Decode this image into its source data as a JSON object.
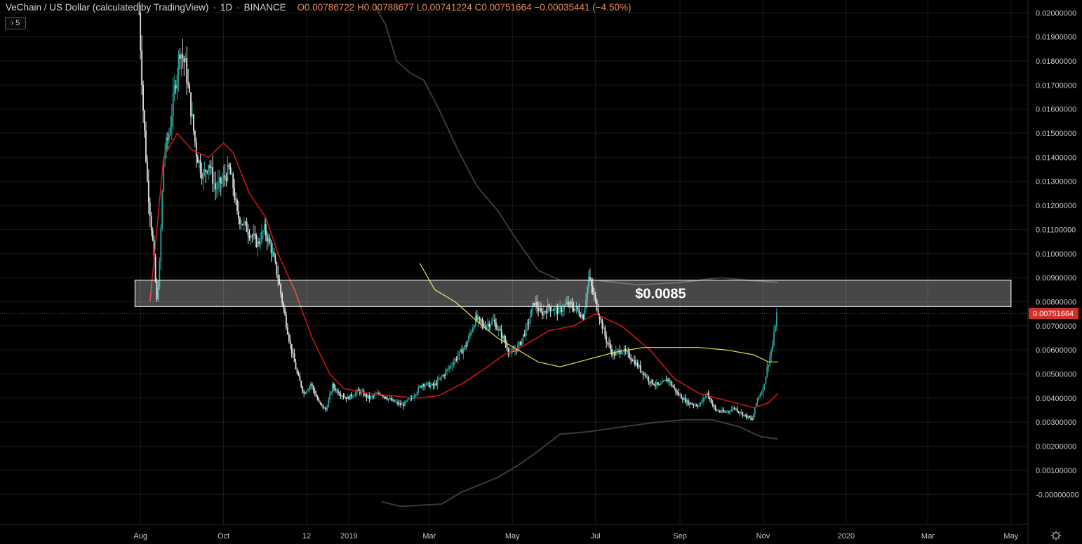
{
  "header": {
    "symbol": "VeChain / US Dollar (calculated by TradingView)",
    "interval": "1D",
    "exchange": "BINANCE",
    "open": "O0.00786722",
    "high": "H0.00788677",
    "low": "L0.00741224",
    "close": "C0.00751664",
    "change": "−0.00035441 (−4.50%)"
  },
  "hidden_indicators_label": "5",
  "settings_icon": "gear-icon",
  "colors": {
    "background": "#000000",
    "grid": "#1c1c1c",
    "axis_text": "#c8c8c8",
    "candle_up": "#26a69a",
    "candle_down": "#e0e0e0",
    "ma_red": "#d41616",
    "ma_yellow": "#e6e04a",
    "band_gray": "#3a3a3a",
    "price_tag": "#d0302a"
  },
  "chart_data": {
    "type": "candlestick",
    "ylim": [
      -0.0004,
      0.0203
    ],
    "y_ticks": [
      "0.02000000",
      "0.01900000",
      "0.01800000",
      "0.01700000",
      "0.01600000",
      "0.01500000",
      "0.01400000",
      "0.01300000",
      "0.01200000",
      "0.01100000",
      "0.01000000",
      "0.00900000",
      "0.00800000",
      "0.00700000",
      "0.00600000",
      "0.00500000",
      "0.00400000",
      "0.00300000",
      "0.00200000",
      "0.00100000",
      "-0.00000000"
    ],
    "y_tick_values": [
      0.02,
      0.019,
      0.018,
      0.017,
      0.016,
      0.015,
      0.014,
      0.013,
      0.012,
      0.011,
      0.01,
      0.009,
      0.008,
      0.007,
      0.006,
      0.005,
      0.004,
      0.003,
      0.002,
      0.001,
      0.0
    ],
    "x_ticks": [
      "Aug",
      "Oct",
      "12",
      "2019",
      "Mar",
      "May",
      "Jul",
      "Sep",
      "Nov",
      "2020",
      "Mar",
      "May"
    ],
    "x_tick_dates": [
      "2018-08-01",
      "2018-10-01",
      "2018-12-01",
      "2019-01-01",
      "2019-03-01",
      "2019-05-01",
      "2019-07-01",
      "2019-09-01",
      "2019-11-01",
      "2020-01-01",
      "2020-03-01",
      "2020-05-01"
    ],
    "last_price": "0.00751664",
    "last_price_value": 0.00751664,
    "zone": {
      "label": "$0.0085",
      "low": 0.0078,
      "high": 0.0089,
      "start": "2018-07-28",
      "end": "2020-05-01"
    },
    "price_path": [
      [
        "2018-07-31",
        0.02
      ],
      [
        "2018-08-03",
        0.016
      ],
      [
        "2018-08-06",
        0.013
      ],
      [
        "2018-08-10",
        0.0105
      ],
      [
        "2018-08-13",
        0.008
      ],
      [
        "2018-08-15",
        0.0095
      ],
      [
        "2018-08-18",
        0.014
      ],
      [
        "2018-08-22",
        0.015
      ],
      [
        "2018-08-26",
        0.0168
      ],
      [
        "2018-08-30",
        0.0185
      ],
      [
        "2018-09-03",
        0.0178
      ],
      [
        "2018-09-07",
        0.016
      ],
      [
        "2018-09-11",
        0.0142
      ],
      [
        "2018-09-16",
        0.0132
      ],
      [
        "2018-09-20",
        0.0138
      ],
      [
        "2018-09-25",
        0.0127
      ],
      [
        "2018-09-30",
        0.013
      ],
      [
        "2018-10-05",
        0.0135
      ],
      [
        "2018-10-08",
        0.0128
      ],
      [
        "2018-10-11",
        0.0116
      ],
      [
        "2018-10-16",
        0.0112
      ],
      [
        "2018-10-21",
        0.0108
      ],
      [
        "2018-10-26",
        0.0104
      ],
      [
        "2018-10-31",
        0.011
      ],
      [
        "2018-11-05",
        0.0102
      ],
      [
        "2018-11-10",
        0.009
      ],
      [
        "2018-11-14",
        0.0077
      ],
      [
        "2018-11-19",
        0.0062
      ],
      [
        "2018-11-24",
        0.005
      ],
      [
        "2018-11-29",
        0.0042
      ],
      [
        "2018-12-04",
        0.0046
      ],
      [
        "2018-12-10",
        0.0038
      ],
      [
        "2018-12-15",
        0.0035
      ],
      [
        "2018-12-20",
        0.0045
      ],
      [
        "2018-12-25",
        0.0042
      ],
      [
        "2018-12-31",
        0.004
      ],
      [
        "2019-01-08",
        0.0043
      ],
      [
        "2019-01-16",
        0.004
      ],
      [
        "2019-01-24",
        0.0042
      ],
      [
        "2019-02-01",
        0.0039
      ],
      [
        "2019-02-09",
        0.0037
      ],
      [
        "2019-02-16",
        0.004
      ],
      [
        "2019-02-24",
        0.0046
      ],
      [
        "2019-03-04",
        0.0045
      ],
      [
        "2019-03-12",
        0.005
      ],
      [
        "2019-03-20",
        0.0056
      ],
      [
        "2019-03-28",
        0.0062
      ],
      [
        "2019-04-04",
        0.0073
      ],
      [
        "2019-04-10",
        0.007
      ],
      [
        "2019-04-17",
        0.0072
      ],
      [
        "2019-04-24",
        0.0065
      ],
      [
        "2019-04-30",
        0.0058
      ],
      [
        "2019-05-06",
        0.0062
      ],
      [
        "2019-05-12",
        0.007
      ],
      [
        "2019-05-17",
        0.008
      ],
      [
        "2019-05-22",
        0.0075
      ],
      [
        "2019-05-28",
        0.0078
      ],
      [
        "2019-06-04",
        0.0076
      ],
      [
        "2019-06-10",
        0.0079
      ],
      [
        "2019-06-17",
        0.0077
      ],
      [
        "2019-06-22",
        0.0074
      ],
      [
        "2019-06-26",
        0.009
      ],
      [
        "2019-07-01",
        0.008
      ],
      [
        "2019-07-05",
        0.0072
      ],
      [
        "2019-07-09",
        0.0064
      ],
      [
        "2019-07-14",
        0.0058
      ],
      [
        "2019-07-20",
        0.006
      ],
      [
        "2019-07-27",
        0.0057
      ],
      [
        "2019-08-03",
        0.0052
      ],
      [
        "2019-08-10",
        0.0047
      ],
      [
        "2019-08-17",
        0.0045
      ],
      [
        "2019-08-23",
        0.0048
      ],
      [
        "2019-08-30",
        0.0042
      ],
      [
        "2019-09-07",
        0.0038
      ],
      [
        "2019-09-15",
        0.0037
      ],
      [
        "2019-09-21",
        0.0042
      ],
      [
        "2019-09-27",
        0.0035
      ],
      [
        "2019-10-04",
        0.0034
      ],
      [
        "2019-10-11",
        0.0036
      ],
      [
        "2019-10-18",
        0.0033
      ],
      [
        "2019-10-24",
        0.0031
      ],
      [
        "2019-10-28",
        0.004
      ],
      [
        "2019-11-01",
        0.0044
      ],
      [
        "2019-11-05",
        0.0055
      ],
      [
        "2019-11-08",
        0.0062
      ],
      [
        "2019-11-11",
        0.0075
      ]
    ],
    "ma_red": [
      [
        "2018-08-08",
        0.008
      ],
      [
        "2018-08-18",
        0.014
      ],
      [
        "2018-08-28",
        0.015
      ],
      [
        "2018-09-08",
        0.0143
      ],
      [
        "2018-09-20",
        0.014
      ],
      [
        "2018-10-01",
        0.0146
      ],
      [
        "2018-10-08",
        0.0142
      ],
      [
        "2018-10-20",
        0.0125
      ],
      [
        "2018-11-01",
        0.0115
      ],
      [
        "2018-11-10",
        0.01
      ],
      [
        "2018-11-22",
        0.0085
      ],
      [
        "2018-12-05",
        0.0065
      ],
      [
        "2018-12-18",
        0.005
      ],
      [
        "2018-12-28",
        0.0044
      ],
      [
        "2019-01-15",
        0.0042
      ],
      [
        "2019-02-01",
        0.0041
      ],
      [
        "2019-02-20",
        0.004
      ],
      [
        "2019-03-08",
        0.0041
      ],
      [
        "2019-03-25",
        0.0046
      ],
      [
        "2019-04-10",
        0.0052
      ],
      [
        "2019-04-25",
        0.0058
      ],
      [
        "2019-05-10",
        0.0062
      ],
      [
        "2019-05-28",
        0.0068
      ],
      [
        "2019-06-15",
        0.007
      ],
      [
        "2019-07-01",
        0.0075
      ],
      [
        "2019-07-20",
        0.007
      ],
      [
        "2019-08-10",
        0.006
      ],
      [
        "2019-08-28",
        0.0048
      ],
      [
        "2019-09-15",
        0.0042
      ],
      [
        "2019-10-05",
        0.0039
      ],
      [
        "2019-10-25",
        0.0036
      ],
      [
        "2019-11-05",
        0.0038
      ],
      [
        "2019-11-12",
        0.0042
      ]
    ],
    "ma_yellow": [
      [
        "2019-02-22",
        0.0096
      ],
      [
        "2019-03-05",
        0.0085
      ],
      [
        "2019-03-20",
        0.008
      ],
      [
        "2019-04-05",
        0.0072
      ],
      [
        "2019-04-20",
        0.0065
      ],
      [
        "2019-05-05",
        0.006
      ],
      [
        "2019-05-20",
        0.0055
      ],
      [
        "2019-06-05",
        0.0053
      ],
      [
        "2019-06-25",
        0.0056
      ],
      [
        "2019-07-15",
        0.0059
      ],
      [
        "2019-08-05",
        0.0061
      ],
      [
        "2019-08-25",
        0.0061
      ],
      [
        "2019-09-15",
        0.0061
      ],
      [
        "2019-10-05",
        0.006
      ],
      [
        "2019-10-25",
        0.0058
      ],
      [
        "2019-11-05",
        0.0055
      ],
      [
        "2019-11-12",
        0.0055
      ]
    ],
    "band_upper": [
      [
        "2019-01-20",
        0.0203
      ],
      [
        "2019-01-28",
        0.0195
      ],
      [
        "2019-02-05",
        0.018
      ],
      [
        "2019-02-15",
        0.0175
      ],
      [
        "2019-02-25",
        0.0172
      ],
      [
        "2019-03-08",
        0.016
      ],
      [
        "2019-03-22",
        0.0143
      ],
      [
        "2019-04-05",
        0.0128
      ],
      [
        "2019-04-20",
        0.0118
      ],
      [
        "2019-05-05",
        0.0105
      ],
      [
        "2019-05-20",
        0.0093
      ],
      [
        "2019-06-05",
        0.0089
      ],
      [
        "2019-07-01",
        0.0089
      ],
      [
        "2019-08-01",
        0.0087
      ],
      [
        "2019-09-01",
        0.0088
      ],
      [
        "2019-10-01",
        0.009
      ],
      [
        "2019-10-20",
        0.0089
      ],
      [
        "2019-11-12",
        0.0088
      ]
    ],
    "band_lower": [
      [
        "2019-01-25",
        -0.0003
      ],
      [
        "2019-02-08",
        -0.0005
      ],
      [
        "2019-03-10",
        -0.0004
      ],
      [
        "2019-03-25",
        0.0001
      ],
      [
        "2019-04-20",
        0.0007
      ],
      [
        "2019-05-05",
        0.0012
      ],
      [
        "2019-05-20",
        0.0018
      ],
      [
        "2019-06-05",
        0.0025
      ],
      [
        "2019-06-25",
        0.0026
      ],
      [
        "2019-07-20",
        0.0028
      ],
      [
        "2019-08-15",
        0.003
      ],
      [
        "2019-09-05",
        0.0031
      ],
      [
        "2019-09-25",
        0.0031
      ],
      [
        "2019-10-15",
        0.0028
      ],
      [
        "2019-10-30",
        0.0024
      ],
      [
        "2019-11-12",
        0.0023
      ]
    ]
  }
}
